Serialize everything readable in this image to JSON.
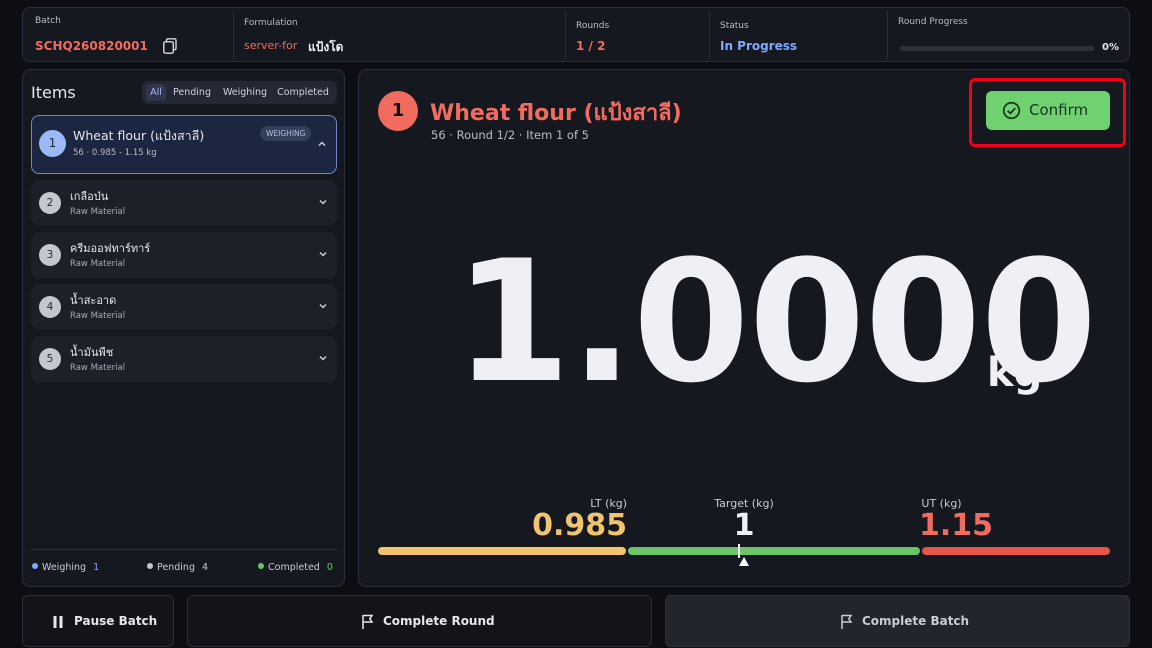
{
  "header": {
    "batch_label": "Batch",
    "batch_value": "SCHQ260820001",
    "formulation_label": "Formulation",
    "formulation_code": "server-for",
    "formulation_name": "แป้งโด",
    "rounds_label": "Rounds",
    "rounds_value": "1 / 2",
    "status_label": "Status",
    "status_value": "In Progress",
    "progress_label": "Round Progress",
    "progress_pct": "0%",
    "progress_fraction": 0
  },
  "items_panel": {
    "title": "Items",
    "filters": [
      "All",
      "Pending",
      "Weighing",
      "Completed"
    ],
    "active_filter": "All",
    "items": [
      {
        "num": "1",
        "name": "Wheat flour (แป้งสาลี)",
        "sub": "56 · 0.985 - 1.15 kg",
        "badge": "WEIGHING"
      },
      {
        "num": "2",
        "name": "เกลือป่น",
        "sub": "Raw Material"
      },
      {
        "num": "3",
        "name": "ครีมออฟทาร์ทาร์",
        "sub": "Raw Material"
      },
      {
        "num": "4",
        "name": "น้ำสะอาด",
        "sub": "Raw Material"
      },
      {
        "num": "5",
        "name": "น้ำมันพืช",
        "sub": "Raw Material"
      }
    ],
    "legend": {
      "weighing_label": "Weighing",
      "weighing_count": "1",
      "pending_label": "Pending",
      "pending_count": "4",
      "completed_label": "Completed",
      "completed_count": "0"
    }
  },
  "main": {
    "item_num": "1",
    "title": "Wheat flour (แป้งสาลี)",
    "subtitle": "56 · Round 1/2 · Item 1 of 5",
    "confirm_label": "Confirm",
    "weight": "1.0000",
    "unit": "kg",
    "lt_label": "LT (kg)",
    "lt_value": "0.985",
    "target_label": "Target (kg)",
    "target_value": "1",
    "ut_label": "UT (kg)",
    "ut_value": "1.15"
  },
  "footer": {
    "pause_label": "Pause Batch",
    "complete_round_label": "Complete Round",
    "complete_batch_label": "Complete Batch"
  },
  "colors": {
    "accent_red": "#f26b5f",
    "accent_blue": "#4b9bff",
    "confirm_green": "#6fd170",
    "lt_yellow": "#f2c46e",
    "ok_green": "#6cc46a",
    "ut_red": "#e8564a"
  },
  "icons": [
    "copy-icon",
    "chevron-up-icon",
    "chevron-down-icon",
    "check-circle-icon",
    "pause-icon",
    "flag-icon"
  ]
}
